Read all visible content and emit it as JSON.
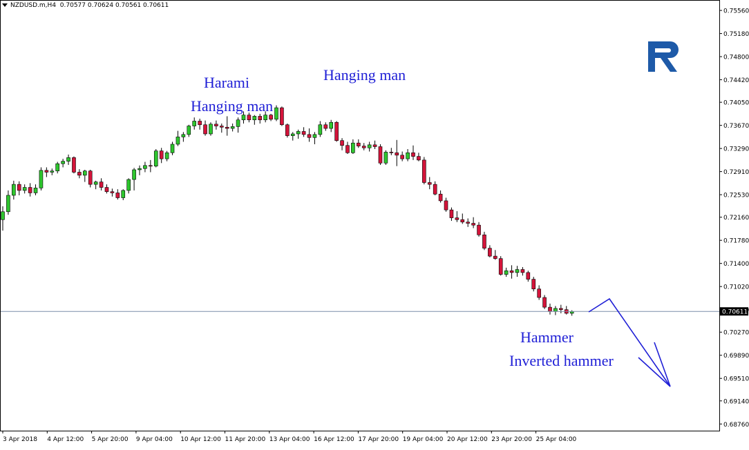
{
  "header": {
    "symbol": "NZDUSD.m,H4",
    "ohlc": "0.70577 0.70624 0.70561 0.70611"
  },
  "colors": {
    "bull": "#2ec52e",
    "bear": "#d4143a",
    "wick": "#000000",
    "annotation": "#1f1fd6",
    "price_line": "#7a8ea8",
    "logo": "#1e5aa8"
  },
  "annotations": {
    "harami": "Harami",
    "hanging_man_1": "Hanging man",
    "hanging_man_2": "Hanging man",
    "hammer": "Hammer",
    "inverted_hammer": "Inverted hammer"
  },
  "chart_data": {
    "type": "candlestick",
    "ylim": [
      0.6865,
      0.7572
    ],
    "y_ticks": [
      "0.75560",
      "0.75180",
      "0.74800",
      "0.74420",
      "0.74050",
      "0.73670",
      "0.73290",
      "0.72910",
      "0.72530",
      "0.72160",
      "0.71780",
      "0.71400",
      "0.71020",
      "0.70640",
      "0.70270",
      "0.69890",
      "0.69510",
      "0.69140",
      "0.68760"
    ],
    "x_ticks": [
      "3 Apr 2018",
      "4 Apr 12:00",
      "5 Apr 20:00",
      "9 Apr 04:00",
      "10 Apr 12:00",
      "11 Apr 20:00",
      "13 Apr 04:00",
      "16 Apr 12:00",
      "17 Apr 20:00",
      "19 Apr 04:00",
      "20 Apr 12:00",
      "23 Apr 20:00",
      "25 Apr 04:00"
    ],
    "current_price": "0.70611",
    "current_price_value": 0.70611,
    "candles": [
      [
        0.7212,
        0.7234,
        0.7194,
        0.7225
      ],
      [
        0.7225,
        0.726,
        0.722,
        0.7252
      ],
      [
        0.7252,
        0.7276,
        0.7245,
        0.727
      ],
      [
        0.727,
        0.7275,
        0.7252,
        0.726
      ],
      [
        0.726,
        0.727,
        0.7255,
        0.7265
      ],
      [
        0.7265,
        0.7272,
        0.725,
        0.7256
      ],
      [
        0.7256,
        0.727,
        0.7252,
        0.7264
      ],
      [
        0.7264,
        0.7298,
        0.726,
        0.7293
      ],
      [
        0.7293,
        0.7298,
        0.7282,
        0.729
      ],
      [
        0.729,
        0.7296,
        0.7285,
        0.7292
      ],
      [
        0.7292,
        0.7307,
        0.7288,
        0.7304
      ],
      [
        0.7304,
        0.7312,
        0.7298,
        0.7308
      ],
      [
        0.7308,
        0.7319,
        0.7302,
        0.7314
      ],
      [
        0.7314,
        0.7316,
        0.7288,
        0.729
      ],
      [
        0.729,
        0.7295,
        0.728,
        0.7285
      ],
      [
        0.7285,
        0.7294,
        0.7274,
        0.7292
      ],
      [
        0.7292,
        0.7294,
        0.7265,
        0.727
      ],
      [
        0.727,
        0.7276,
        0.7262,
        0.7274
      ],
      [
        0.7274,
        0.728,
        0.726,
        0.7265
      ],
      [
        0.7265,
        0.727,
        0.7255,
        0.7258
      ],
      [
        0.7258,
        0.7263,
        0.725,
        0.7256
      ],
      [
        0.7256,
        0.7262,
        0.7245,
        0.7248
      ],
      [
        0.7248,
        0.7262,
        0.7244,
        0.726
      ],
      [
        0.726,
        0.728,
        0.7255,
        0.7278
      ],
      [
        0.7278,
        0.7297,
        0.726,
        0.7294
      ],
      [
        0.7294,
        0.7301,
        0.7285,
        0.7296
      ],
      [
        0.7296,
        0.7307,
        0.729,
        0.7301
      ],
      [
        0.7301,
        0.731,
        0.729,
        0.73
      ],
      [
        0.73,
        0.7328,
        0.7298,
        0.7325
      ],
      [
        0.7325,
        0.733,
        0.7305,
        0.7312
      ],
      [
        0.7312,
        0.7325,
        0.7308,
        0.7322
      ],
      [
        0.7322,
        0.734,
        0.7318,
        0.7336
      ],
      [
        0.7336,
        0.7358,
        0.7333,
        0.7348
      ],
      [
        0.7348,
        0.7356,
        0.734,
        0.7352
      ],
      [
        0.7352,
        0.7368,
        0.7348,
        0.7366
      ],
      [
        0.7366,
        0.738,
        0.736,
        0.7374
      ],
      [
        0.7374,
        0.7378,
        0.736,
        0.7368
      ],
      [
        0.7368,
        0.7375,
        0.735,
        0.7353
      ],
      [
        0.7353,
        0.7372,
        0.735,
        0.7369
      ],
      [
        0.7369,
        0.7375,
        0.736,
        0.7366
      ],
      [
        0.7366,
        0.737,
        0.7355,
        0.7364
      ],
      [
        0.7364,
        0.7382,
        0.735,
        0.7362
      ],
      [
        0.7362,
        0.737,
        0.7357,
        0.7365
      ],
      [
        0.7365,
        0.738,
        0.7355,
        0.7376
      ],
      [
        0.7376,
        0.739,
        0.737,
        0.7384
      ],
      [
        0.7384,
        0.7388,
        0.7372,
        0.7376
      ],
      [
        0.7376,
        0.7384,
        0.7368,
        0.7382
      ],
      [
        0.7382,
        0.7386,
        0.737,
        0.7376
      ],
      [
        0.7376,
        0.739,
        0.7372,
        0.7384
      ],
      [
        0.7384,
        0.7386,
        0.7374,
        0.7377
      ],
      [
        0.7377,
        0.74,
        0.7374,
        0.7396
      ],
      [
        0.7396,
        0.7398,
        0.7366,
        0.7368
      ],
      [
        0.7368,
        0.737,
        0.7347,
        0.735
      ],
      [
        0.735,
        0.7356,
        0.7342,
        0.7353
      ],
      [
        0.7353,
        0.736,
        0.7345,
        0.7357
      ],
      [
        0.7357,
        0.7364,
        0.7348,
        0.7352
      ],
      [
        0.7352,
        0.7362,
        0.734,
        0.7347
      ],
      [
        0.7347,
        0.7356,
        0.7336,
        0.7352
      ],
      [
        0.7352,
        0.7374,
        0.7348,
        0.7368
      ],
      [
        0.7368,
        0.7372,
        0.7358,
        0.7362
      ],
      [
        0.7362,
        0.7376,
        0.7356,
        0.7372
      ],
      [
        0.7372,
        0.7374,
        0.734,
        0.7342
      ],
      [
        0.7342,
        0.7346,
        0.7326,
        0.7334
      ],
      [
        0.7334,
        0.734,
        0.732,
        0.7322
      ],
      [
        0.7322,
        0.7344,
        0.732,
        0.7338
      ],
      [
        0.7338,
        0.7344,
        0.733,
        0.7333
      ],
      [
        0.7333,
        0.7338,
        0.7326,
        0.733
      ],
      [
        0.733,
        0.734,
        0.7324,
        0.7335
      ],
      [
        0.7335,
        0.7342,
        0.7328,
        0.7332
      ],
      [
        0.7332,
        0.7336,
        0.7302,
        0.7305
      ],
      [
        0.7305,
        0.7326,
        0.7302,
        0.7323
      ],
      [
        0.7323,
        0.733,
        0.7318,
        0.7322
      ],
      [
        0.7322,
        0.7343,
        0.73,
        0.7318
      ],
      [
        0.7318,
        0.7324,
        0.7308,
        0.7312
      ],
      [
        0.7312,
        0.7328,
        0.7308,
        0.7322
      ],
      [
        0.7322,
        0.7334,
        0.731,
        0.7316
      ],
      [
        0.7316,
        0.7322,
        0.7308,
        0.731
      ],
      [
        0.731,
        0.7315,
        0.727,
        0.7273
      ],
      [
        0.7273,
        0.7282,
        0.7262,
        0.727
      ],
      [
        0.727,
        0.7275,
        0.7252,
        0.7254
      ],
      [
        0.7254,
        0.726,
        0.724,
        0.7243
      ],
      [
        0.7243,
        0.7248,
        0.7225,
        0.7228
      ],
      [
        0.7228,
        0.7232,
        0.721,
        0.7215
      ],
      [
        0.7215,
        0.7226,
        0.7208,
        0.7212
      ],
      [
        0.7212,
        0.7222,
        0.7205,
        0.7208
      ],
      [
        0.7208,
        0.7214,
        0.72,
        0.7206
      ],
      [
        0.7206,
        0.7216,
        0.7198,
        0.7203
      ],
      [
        0.7203,
        0.7208,
        0.7184,
        0.7187
      ],
      [
        0.7187,
        0.7192,
        0.7162,
        0.7165
      ],
      [
        0.7165,
        0.717,
        0.715,
        0.7152
      ],
      [
        0.7152,
        0.7162,
        0.7146,
        0.7148
      ],
      [
        0.7148,
        0.7152,
        0.712,
        0.7122
      ],
      [
        0.7122,
        0.7133,
        0.7118,
        0.7128
      ],
      [
        0.7128,
        0.7137,
        0.7115,
        0.7125
      ],
      [
        0.7125,
        0.7136,
        0.7118,
        0.713
      ],
      [
        0.713,
        0.7134,
        0.712,
        0.7125
      ],
      [
        0.7125,
        0.7128,
        0.711,
        0.7114
      ],
      [
        0.7114,
        0.7118,
        0.7094,
        0.7098
      ],
      [
        0.7098,
        0.7104,
        0.708,
        0.7084
      ],
      [
        0.7084,
        0.7088,
        0.7065,
        0.7068
      ],
      [
        0.7068,
        0.7074,
        0.7056,
        0.7061
      ],
      [
        0.7061,
        0.707,
        0.7055,
        0.7066
      ],
      [
        0.7066,
        0.7072,
        0.7058,
        0.7064
      ],
      [
        0.7064,
        0.707,
        0.7056,
        0.7058
      ],
      [
        0.7058,
        0.7063,
        0.7054,
        0.7061
      ]
    ]
  }
}
